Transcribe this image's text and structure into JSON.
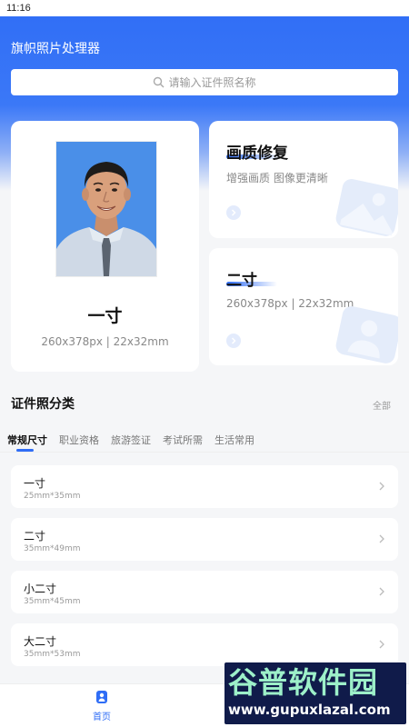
{
  "status_bar": {
    "time": "11:16"
  },
  "app": {
    "title": "旗帜照片处理器"
  },
  "search": {
    "placeholder": "请输入证件照名称"
  },
  "featured": {
    "main": {
      "title": "一寸",
      "subtitle": "260x378px | 22x32mm"
    },
    "repair": {
      "title": "画质修复",
      "subtitle": "增强画质 图像更清晰"
    },
    "size": {
      "title": "二寸",
      "subtitle": "260x378px | 22x32mm"
    }
  },
  "categories": {
    "title": "证件照分类",
    "all_label": "全部",
    "tabs": [
      {
        "label": "常规尺寸",
        "active": true
      },
      {
        "label": "职业资格",
        "active": false
      },
      {
        "label": "旅游签证",
        "active": false
      },
      {
        "label": "考试所需",
        "active": false
      },
      {
        "label": "生活常用",
        "active": false
      }
    ]
  },
  "items": [
    {
      "name": "一寸",
      "size": "25mm*35mm"
    },
    {
      "name": "二寸",
      "size": "35mm*49mm"
    },
    {
      "name": "小二寸",
      "size": "35mm*45mm"
    },
    {
      "name": "大二寸",
      "size": "35mm*53mm"
    }
  ],
  "bottom_nav": {
    "home_label": "首页"
  },
  "watermark": {
    "line1": "谷普软件园",
    "line2": "www.gupuxlazal.com"
  },
  "colors": {
    "accent": "#2f6df6",
    "photo_bg": "#4a8fe8"
  },
  "icons": [
    "search-icon",
    "arrow-right-icon",
    "chevron-right-icon",
    "home-icon",
    "image-deco-icon",
    "person-deco-icon"
  ]
}
